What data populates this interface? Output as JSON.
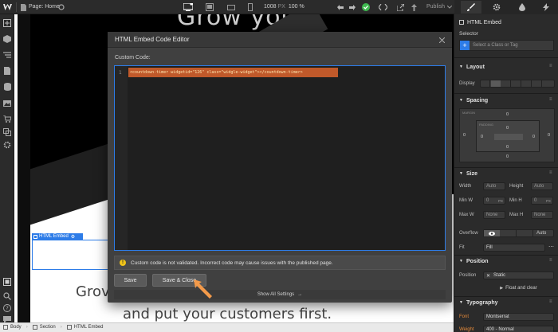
{
  "topbar": {
    "page_label": "Page: Home",
    "width_value": "1008",
    "width_unit": "PX",
    "zoom": "100 %",
    "publish_label": "Publish"
  },
  "canvas": {
    "hero_top_text": "Grow your",
    "grow_text": "Grov",
    "customers_text": "and put your customers first.",
    "embed_tag_label": "HTML Embed"
  },
  "modal": {
    "title": "HTML Embed Code Editor",
    "custom_code_label": "Custom Code:",
    "line_number": "1",
    "code_line": "<countdown-timer widgetid=\"126\" class=\"widgle-widget\"></countdown-timer>",
    "warning_text": "Custom code is not validated. Incorrect code may cause issues with the published page.",
    "save_label": "Save",
    "save_close_label": "Save & Close",
    "show_all_settings": "Show All Settings"
  },
  "panel": {
    "element_name": "HTML Embed",
    "selector_label": "Selector",
    "selector_placeholder": "Select a Class or Tag",
    "layout_title": "Layout",
    "display_label": "Display",
    "spacing_title": "Spacing",
    "margin_label": "MARGIN",
    "padding_label": "PADDING",
    "zero": "0",
    "size_title": "Size",
    "width_label": "Width",
    "height_label": "Height",
    "minw_label": "Min W",
    "minh_label": "Min H",
    "maxw_label": "Max W",
    "maxh_label": "Max H",
    "auto": "Auto",
    "none": "None",
    "px_zero": "0",
    "px_unit": "PX",
    "overflow_label": "Overflow",
    "overflow_auto": "Auto",
    "fit_label": "Fit",
    "fit_value": "Fill",
    "position_title": "Position",
    "position_label": "Position",
    "position_value": "Static",
    "float_clear": "Float and clear",
    "typography_title": "Typography",
    "font_label": "Font",
    "font_value": "Montserrat",
    "weight_label": "Weight",
    "weight_value": "400 - Normal"
  },
  "breadcrumb": {
    "items": [
      "Body",
      "Section",
      "HTML Embed"
    ]
  },
  "colors": {
    "accent_blue": "#2d7ce8",
    "code_highlight": "#c0592a",
    "publish_green": "#3fb950",
    "warning_yellow": "#f0c419",
    "arrow_orange": "#f39a4a"
  }
}
